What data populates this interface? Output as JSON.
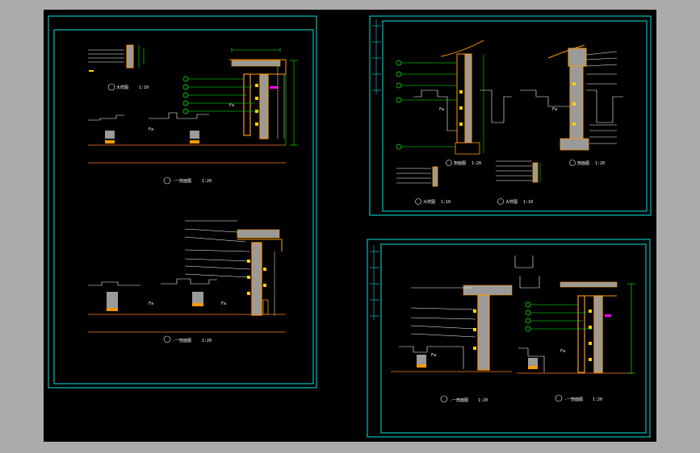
{
  "sheets": [
    {
      "id": "left",
      "views": [
        {
          "id": "top",
          "title": "-一剖面图",
          "scale": "1:20",
          "detail_title": "大样图",
          "detail_scale": "1:10",
          "annotations": [
            "",
            "",
            "",
            "",
            ""
          ]
        },
        {
          "id": "bottom",
          "title": "-一剖面图",
          "scale": "1:20",
          "annotations": [
            "",
            "",
            "",
            "",
            "",
            "",
            ""
          ]
        }
      ]
    },
    {
      "id": "top-right",
      "views": [
        {
          "id": "a",
          "title": "剖面图",
          "scale": "1:20"
        },
        {
          "id": "b",
          "title": "剖面图",
          "scale": "1:20"
        },
        {
          "id": "c",
          "title": "大样图",
          "scale": "1:10"
        },
        {
          "id": "d",
          "title": "大样图",
          "scale": "1:10"
        }
      ]
    },
    {
      "id": "bottom-right",
      "views": [
        {
          "id": "a",
          "title": "-一剖面图",
          "scale": "1:20"
        },
        {
          "id": "b",
          "title": "-一剖面图",
          "scale": "1:20"
        }
      ]
    }
  ],
  "colors": {
    "background": "#000000",
    "frame": "#00e5e5",
    "structure": "#ff9900",
    "ground": "#ff7a2a",
    "fill": "#9a9a9a",
    "dimension": "#00ff00",
    "leader": "#ffffff",
    "highlight": "#ff00ff",
    "accent": "#ffd400"
  }
}
